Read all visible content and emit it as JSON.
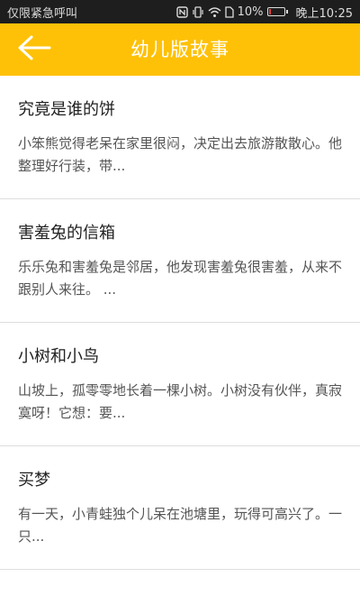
{
  "status_bar": {
    "left_text": "仅限紧急呼叫",
    "battery_percent": "10%",
    "battery_level": 0.1,
    "battery_color": "#e23b3b",
    "time": "晚上10:25",
    "icons": [
      "nfc-icon",
      "vibrate-icon",
      "wifi-icon",
      "sim-icon",
      "battery-icon"
    ]
  },
  "app_bar": {
    "title": "幼儿版故事",
    "background_color": "#ffc107",
    "back_icon": "arrow-left-icon"
  },
  "stories": [
    {
      "title": "究竟是谁的饼",
      "summary": "小笨熊觉得老呆在家里很闷，决定出去旅游散散心。他整理好行装，带..."
    },
    {
      "title": "害羞兔的信箱",
      "summary": "乐乐兔和害羞兔是邻居，他发现害羞兔很害羞，从来不跟别人来往。 ..."
    },
    {
      "title": "小树和小鸟",
      "summary": "山坡上，孤零零地长着一棵小树。小树没有伙伴，真寂寞呀！它想：要..."
    },
    {
      "title": "买梦",
      "summary": "有一天，小青蛙独个儿呆在池塘里，玩得可高兴了。一只..."
    }
  ]
}
